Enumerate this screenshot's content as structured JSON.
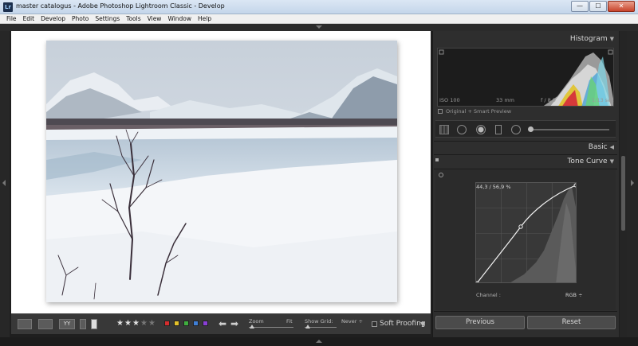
{
  "window": {
    "title": "master catalogus - Adobe Photoshop Lightroom Classic - Develop",
    "app_icon_text": "Lr",
    "minimize": "—",
    "maximize": "☐",
    "close": "✕"
  },
  "menu": [
    "File",
    "Edit",
    "Develop",
    "Photo",
    "Settings",
    "Tools",
    "View",
    "Window",
    "Help"
  ],
  "panels": {
    "histogram": {
      "title": "Histogram",
      "iso": "ISO 100",
      "focal": "33 mm",
      "aperture": "f / 8,0",
      "shutter": "1/13 sec",
      "preview": "Original + Smart Preview"
    },
    "basic": {
      "title": "Basic"
    },
    "tone_curve": {
      "title": "Tone Curve",
      "readout": "44,3 / 56,9 %",
      "channel_label": "Channel :",
      "channel_value": "RGB ÷"
    }
  },
  "toolbar": {
    "view_yy": "YY",
    "zoom_label": "Zoom",
    "zoom_value": "Fit",
    "show_grid_label": "Show Grid:",
    "show_grid_value": "Never ÷",
    "soft_proofing": "Soft Proofing",
    "rating": 3,
    "max_rating": 5,
    "label_colors": [
      "#d32d2d",
      "#e3c12a",
      "#3fae3f",
      "#3f7fd6",
      "#8a3fd6"
    ]
  },
  "buttons": {
    "previous": "Previous",
    "reset": "Reset"
  },
  "icons": {
    "expand_down": "triangle-down-icon",
    "collapse_left": "triangle-left-icon"
  }
}
